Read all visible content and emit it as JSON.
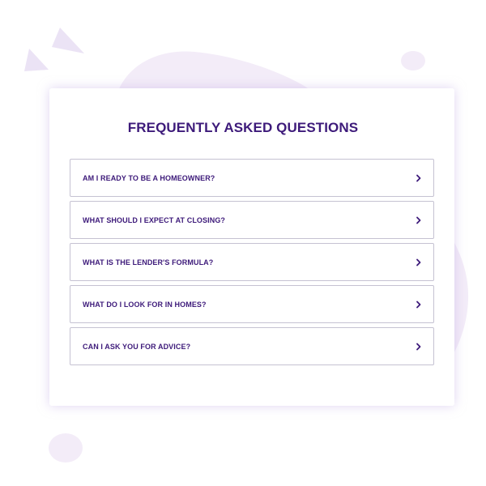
{
  "faq": {
    "title": "FREQUENTLY ASKED QUESTIONS",
    "items": [
      {
        "question": "AM I READY TO BE A HOMEOWNER?",
        "icon": "chevron-right-icon"
      },
      {
        "question": "WHAT SHOULD I EXPECT AT CLOSING?",
        "icon": "chevron-right-icon"
      },
      {
        "question": "WHAT IS THE LENDER'S FORMULA?",
        "icon": "chevron-right-icon"
      },
      {
        "question": "WHAT DO I LOOK FOR IN HOMES?",
        "icon": "chevron-right-icon"
      },
      {
        "question": "CAN I ASK YOU FOR ADVICE?",
        "icon": "chevron-right-icon"
      }
    ]
  },
  "colors": {
    "heading": "#3d1a7a",
    "item_border": "#c5c2d2",
    "decor_blob": "#f3ecf8",
    "decor_triangle": "#ebe3f5"
  }
}
